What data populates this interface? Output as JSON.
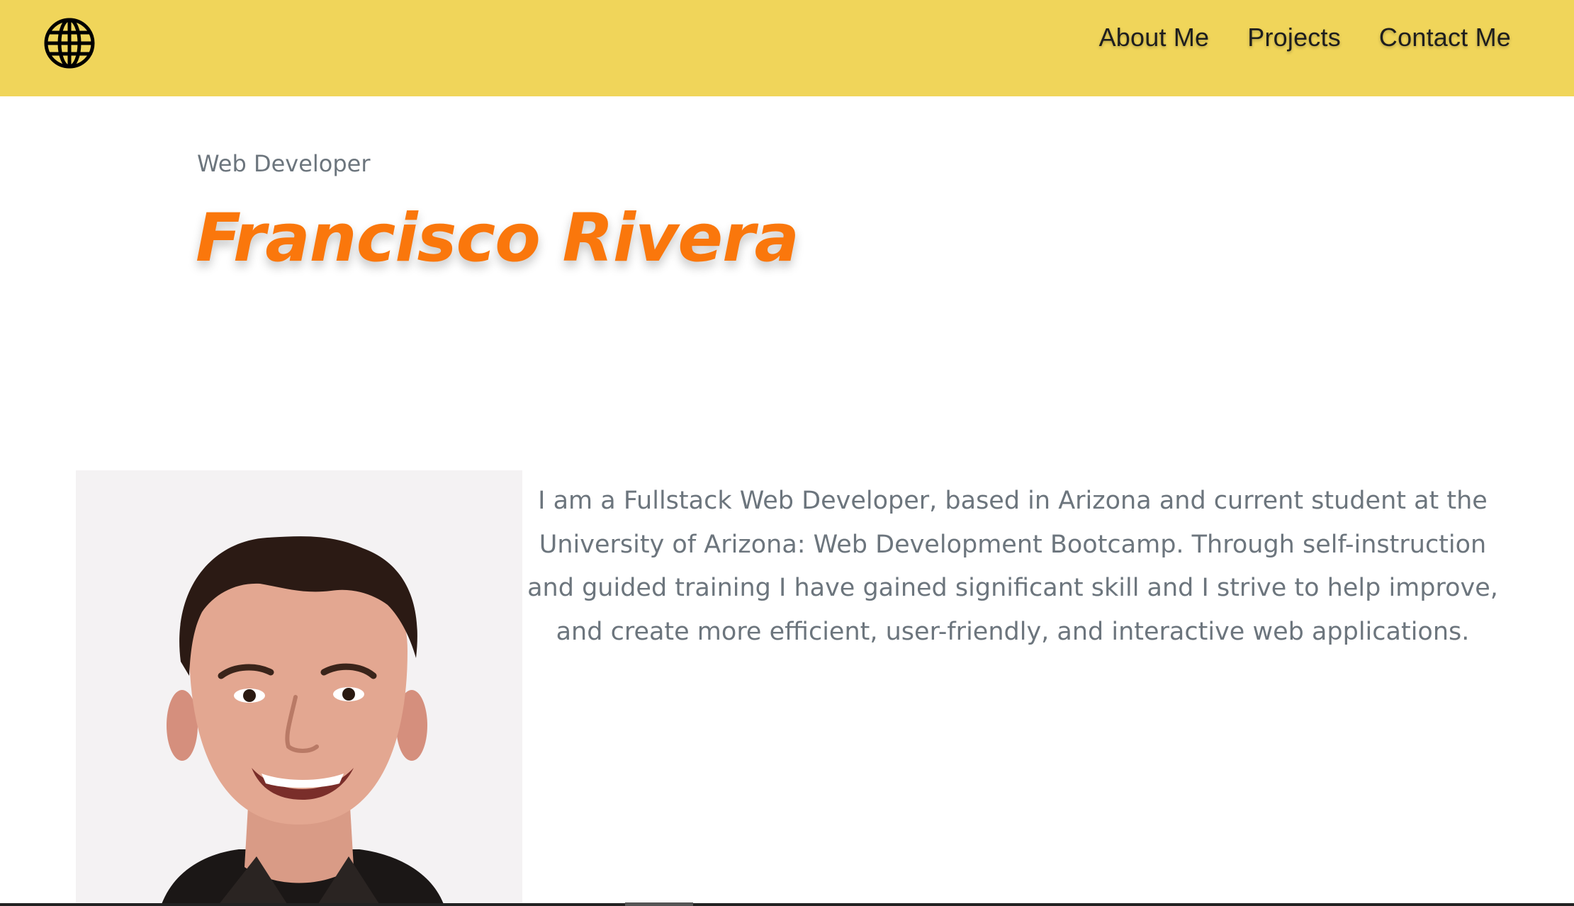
{
  "header": {
    "logo_icon": "globe-icon",
    "background_color": "#f0d55a",
    "nav": [
      {
        "label": "About Me"
      },
      {
        "label": "Projects"
      },
      {
        "label": "Contact Me"
      }
    ]
  },
  "hero": {
    "eyebrow": "Web Developer",
    "name": "Francisco Rivera",
    "name_color": "#fa770c"
  },
  "about": {
    "portrait_icon": "profile-photo",
    "bio": "I am a Fullstack Web Developer, based in Arizona and current student at the University of Arizona: Web Development Bootcamp. Through self-instruction and guided training I have gained significant skill and I strive to help improve, and create more efficient, user-friendly, and interactive web applications."
  }
}
